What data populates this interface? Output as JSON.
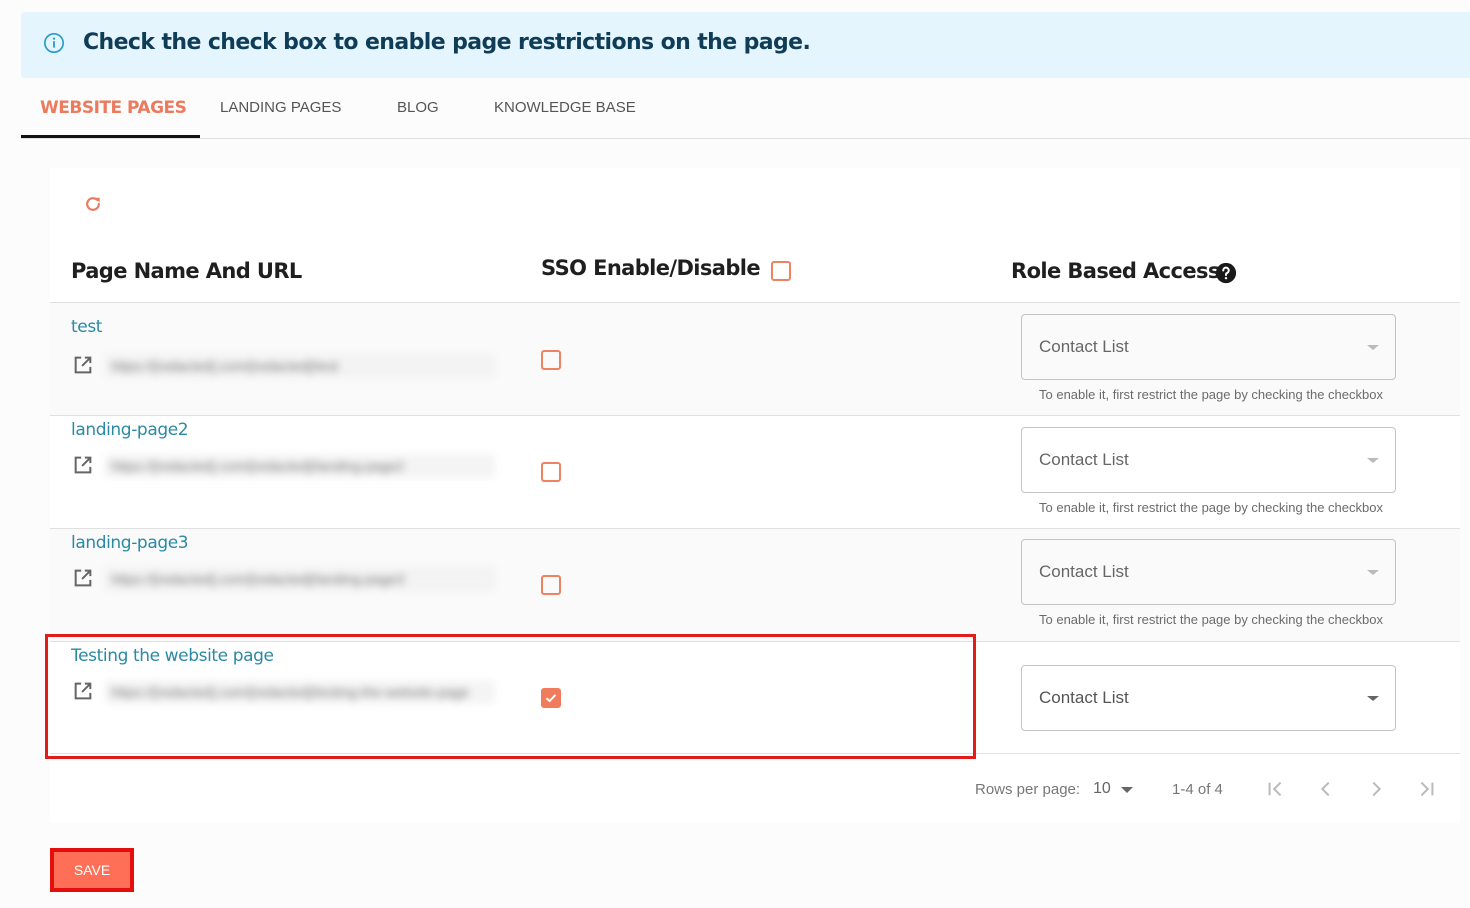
{
  "banner": {
    "icon": "info-circle-icon",
    "message": "Check the check box to enable page restrictions on the page."
  },
  "tabs": [
    {
      "label": "WEBSITE PAGES",
      "active": true
    },
    {
      "label": "LANDING PAGES",
      "active": false
    },
    {
      "label": "BLOG",
      "active": false
    },
    {
      "label": "KNOWLEDGE BASE",
      "active": false
    }
  ],
  "toolbar": {
    "refresh_icon": "refresh-icon"
  },
  "table": {
    "headers": {
      "page": "Page Name And URL",
      "sso": "SSO Enable/Disable",
      "sso_select_all_checked": false,
      "role": "Role Based Access",
      "role_help_icon": "help-circle-icon"
    },
    "rows": [
      {
        "name": "test",
        "url": "https://[redacted].com/[redacted]/test",
        "sso_checked": false,
        "role_value": "Contact List",
        "role_enabled": false,
        "helper": "To enable it, first restrict the page by checking the checkbox"
      },
      {
        "name": "landing-page2",
        "url": "https://[redacted].com/[redacted]/landing-page2",
        "sso_checked": false,
        "role_value": "Contact List",
        "role_enabled": false,
        "helper": "To enable it, first restrict the page by checking the checkbox"
      },
      {
        "name": "landing-page3",
        "url": "https://[redacted].com/[redacted]/landing-page3",
        "sso_checked": false,
        "role_value": "Contact List",
        "role_enabled": false,
        "helper": "To enable it, first restrict the page by checking the checkbox"
      },
      {
        "name": "Testing the website page",
        "url": "https://[redacted].com/[redacted]/testing-the-website-page",
        "sso_checked": true,
        "role_value": "Contact List",
        "role_enabled": true,
        "helper": ""
      }
    ]
  },
  "pagination": {
    "rows_per_page_label": "Rows per page:",
    "rows_per_page": "10",
    "range": "1-4 of 4"
  },
  "actions": {
    "save_label": "SAVE"
  },
  "colors": {
    "accent": "#ec7a5d",
    "link": "#2a8aa4",
    "banner_bg": "#e5f5fd",
    "banner_text": "#0f3d57",
    "highlight": "#e21b1b"
  }
}
